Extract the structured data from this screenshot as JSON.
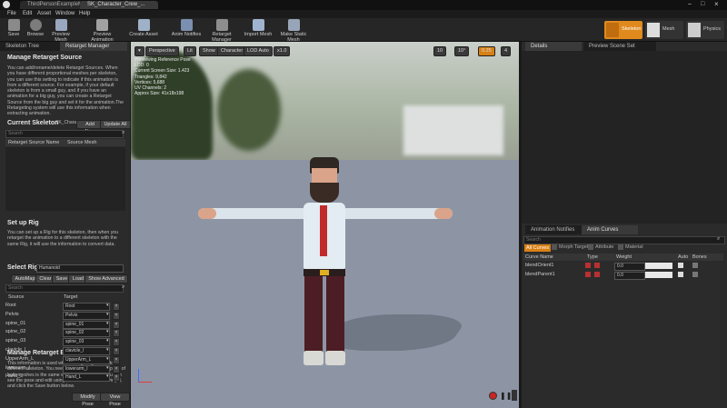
{
  "titlebar": {
    "tabs": [
      "ThirdPersonExampleMap",
      "SK_Character_Crew_..."
    ]
  },
  "menubar": {
    "items": [
      "File",
      "Edit",
      "Asset",
      "Window",
      "Help"
    ]
  },
  "toolbar": {
    "buttons": [
      "Save",
      "Browse",
      "Preview Mesh",
      "Preview Animation",
      "Create Asset",
      "Anim Notifies",
      "Retarget Manager",
      "Import Mesh",
      "Make Static Mesh"
    ],
    "modes": [
      "Skeleton",
      "Mesh",
      "Physics"
    ]
  },
  "left": {
    "tabs": [
      "Skeleton Tree",
      "Retarget Manager"
    ],
    "manage_title": "Manage Retarget Source",
    "manage_text": "You can add/rename/delete Retarget Sources. When you have different proportional meshes per skeleton, you can use this setting to indicate if this animation is from a different source. For example, if your default skeleton is from a small guy, and if you have an animation for a big guy, you can create a Retarget Source from the big guy and set it for the animation.The Retargeting system will use this information when extracting animation.",
    "current_skeleton_label": "Current Skeleton",
    "current_skeleton_value": "SK_Charac",
    "add_new": "Add New",
    "update_all": "Update All",
    "search_placeholder": "Search",
    "source_cols": [
      "Retarget Source Name",
      "Source Mesh"
    ],
    "setup_title": "Set up Rig",
    "setup_text": "You can set up a Rig for this skeleton, then when you retarget the animation to a different skeleton with the same Rig, it will use the information to convert data.",
    "select_rig_label": "Select Rig",
    "select_rig_value": "Humanoid",
    "rig_buttons": [
      "AutoMap",
      "Clear",
      "Save",
      "Load",
      "Show Advanced"
    ],
    "rig_cols": [
      "Source",
      "Target"
    ],
    "rig_rows": [
      {
        "source": "Root",
        "target": "Root"
      },
      {
        "source": "Pelvis",
        "target": "Pelvis"
      },
      {
        "source": "spine_01",
        "target": "spine_01"
      },
      {
        "source": "spine_02",
        "target": "spine_02"
      },
      {
        "source": "spine_03",
        "target": "spine_03"
      },
      {
        "source": "clavicle_l",
        "target": "clavicle_l"
      },
      {
        "source": "UpperArm_L",
        "target": "UpperArm_L"
      },
      {
        "source": "lowerarm_l",
        "target": "lowerarm_l"
      },
      {
        "source": "Hand_L",
        "target": "Hand_L"
      }
    ],
    "basepose_title": "Manage Retarget Base Pose",
    "basepose_text": "This information is used when retargeting assets to a different skeleton. You need to make sure the ref pose of both meshes is the same when retargeting, so you can see the pose and edit using the bone transform widget, and click the Save button below.",
    "modify_pose": "Modify Pose",
    "view_pose": "View Pose"
  },
  "viewport": {
    "buttons": [
      "Perspective",
      "Lit",
      "Show",
      "Character",
      "LOD Auto",
      "x1.0"
    ],
    "right_buttons": [
      "10",
      "10°",
      "0.25",
      "4"
    ],
    "stats": [
      "Previewing Reference Pose",
      "LOD: 0",
      "Current Screen Size: 1.423",
      "Triangles: 9,842",
      "Vertices: 5,688",
      "UV Channels: 2",
      "Approx Size: 41x18x198"
    ]
  },
  "right": {
    "top_tabs": [
      "Details",
      "Preview Scene Set"
    ],
    "bottom_tabs": [
      "Animation Notifies",
      "Anim Curves"
    ],
    "search_placeholder": "Search",
    "filters": [
      "All Curves",
      "Morph Target",
      "Attribute",
      "Material"
    ],
    "curve_cols": [
      "Curve Name",
      "Type",
      "Weight",
      "Auto",
      "Bones"
    ],
    "curves": [
      {
        "name": "blendOrient1",
        "weight": "0.0"
      },
      {
        "name": "blendParent1",
        "weight": "0.0"
      }
    ]
  }
}
